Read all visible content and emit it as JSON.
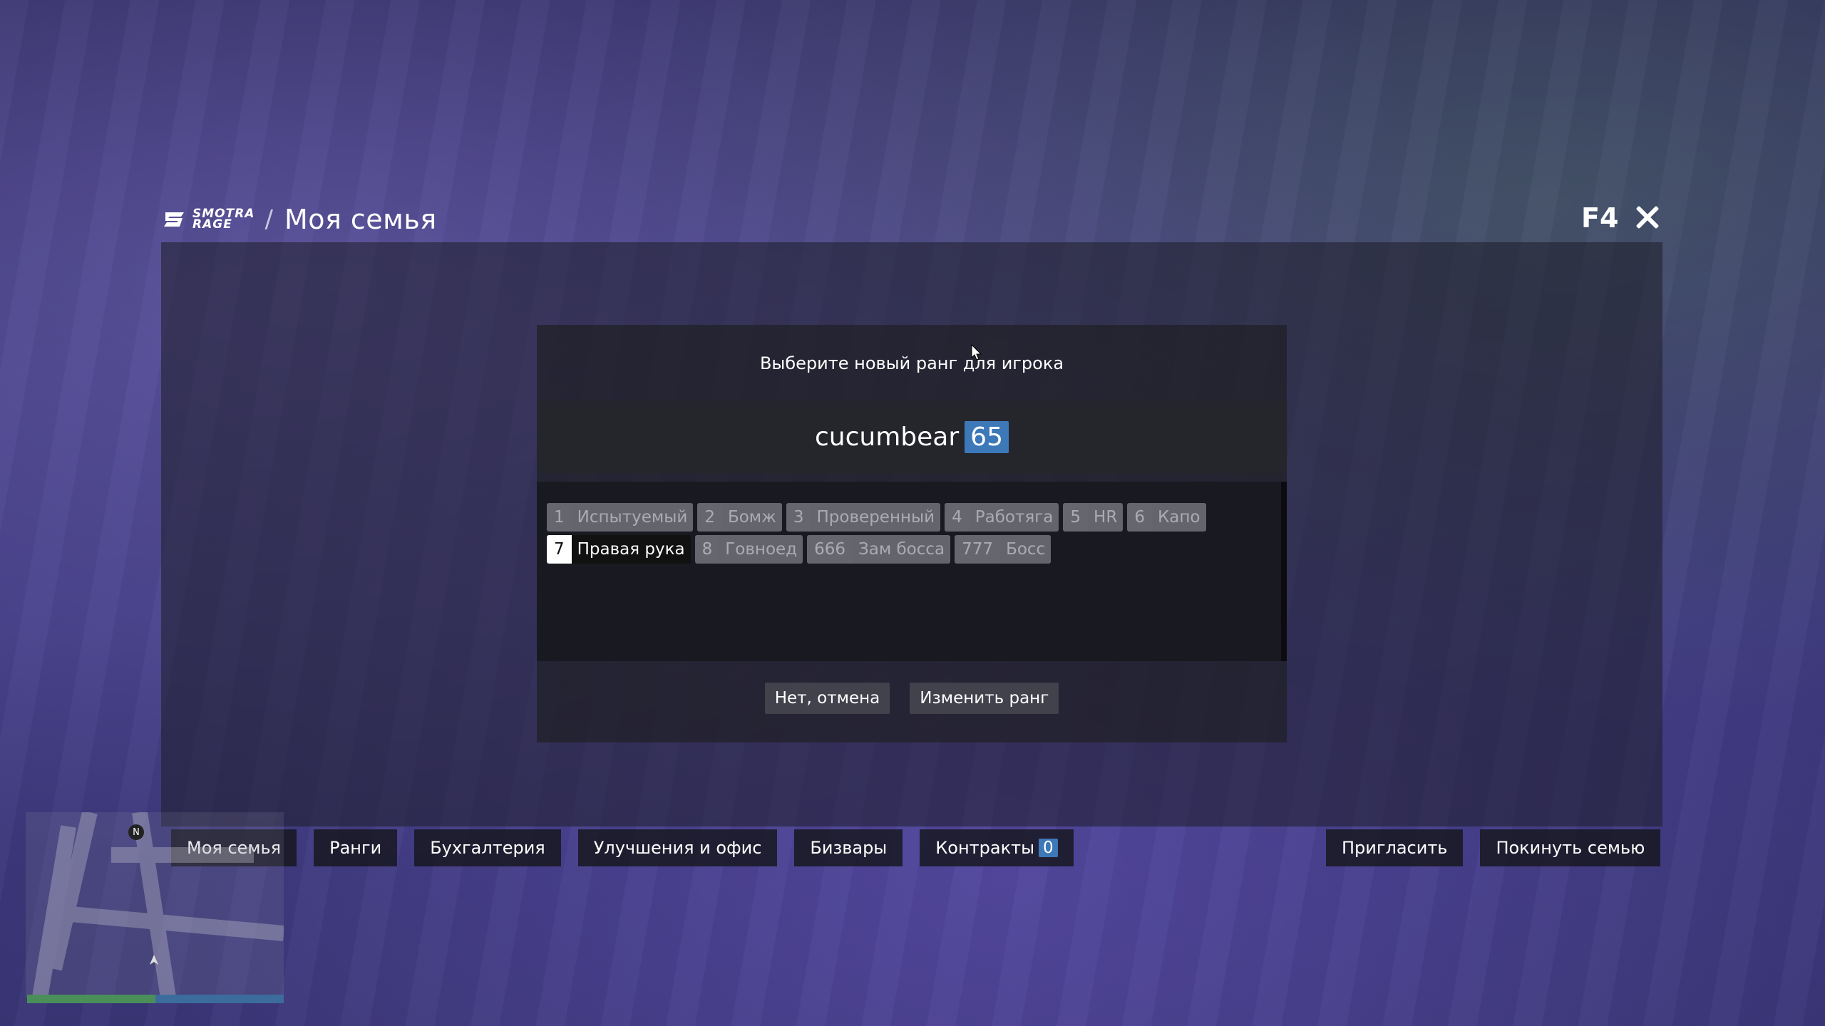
{
  "brand": {
    "logo_line1": "SMOTRA",
    "logo_line2": "RAGE",
    "separator": "/",
    "page_title": "Моя семья"
  },
  "window": {
    "hotkey": "F4"
  },
  "dialog": {
    "prompt": "Выберите новый ранг для игрока",
    "player": {
      "name": "cucumbear",
      "level": "65"
    },
    "ranks_row1": [
      {
        "num": "1",
        "name": "Испытуемый"
      },
      {
        "num": "2",
        "name": "Бомж"
      },
      {
        "num": "3",
        "name": "Проверенный"
      },
      {
        "num": "4",
        "name": "Работяга"
      },
      {
        "num": "5",
        "name": "HR"
      },
      {
        "num": "6",
        "name": "Капо"
      }
    ],
    "ranks_row2": [
      {
        "num": "7",
        "name": "Правая рука",
        "selected": true
      },
      {
        "num": "8",
        "name": "Говноед"
      },
      {
        "num": "666",
        "name": "Зам босса"
      },
      {
        "num": "777",
        "name": "Босс"
      }
    ],
    "cancel_label": "Нет, отмена",
    "confirm_label": "Изменить ранг"
  },
  "tabs": [
    {
      "label": "Моя семья"
    },
    {
      "label": "Ранги"
    },
    {
      "label": "Бухгалтерия"
    },
    {
      "label": "Улучшения и офис"
    },
    {
      "label": "Бизвары"
    },
    {
      "label": "Контракты",
      "badge": "0"
    }
  ],
  "right_actions": [
    {
      "label": "Пригласить"
    },
    {
      "label": "Покинуть семью"
    }
  ],
  "minimap": {
    "north_label": "N"
  },
  "colors": {
    "accent": "#3d78b8",
    "health": "#4a8f5a",
    "armor": "#3c6c9c"
  }
}
